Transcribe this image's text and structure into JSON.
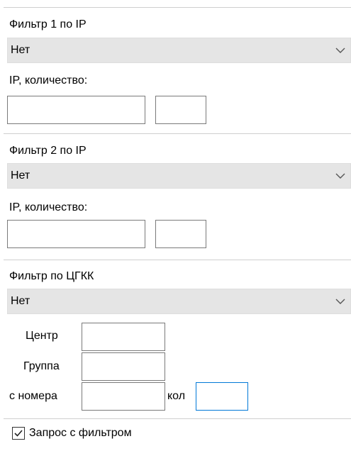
{
  "colors": {
    "dropdown_bg": "#e5e5e5",
    "input_border": "#7a7a7a",
    "focus_border": "#0078d7"
  },
  "filter1": {
    "title": "Фильтр 1 по IP",
    "selected": "Нет",
    "ip_count_label": "IP, количество:",
    "ip_value": "",
    "count_value": ""
  },
  "filter2": {
    "title": "Фильтр 2 по IP",
    "selected": "Нет",
    "ip_count_label": "IP, количество:",
    "ip_value": "",
    "count_value": ""
  },
  "cgkk": {
    "title": "Фильтр по ЦГКК",
    "selected": "Нет",
    "center_label": "Центр",
    "center_value": "",
    "group_label": "Группа",
    "group_value": "",
    "from_number_label": "с номера",
    "from_number_value": "",
    "count_label": "кол",
    "count_value": ""
  },
  "request_filter": {
    "label": "Запрос с фильтром",
    "checked": true
  }
}
